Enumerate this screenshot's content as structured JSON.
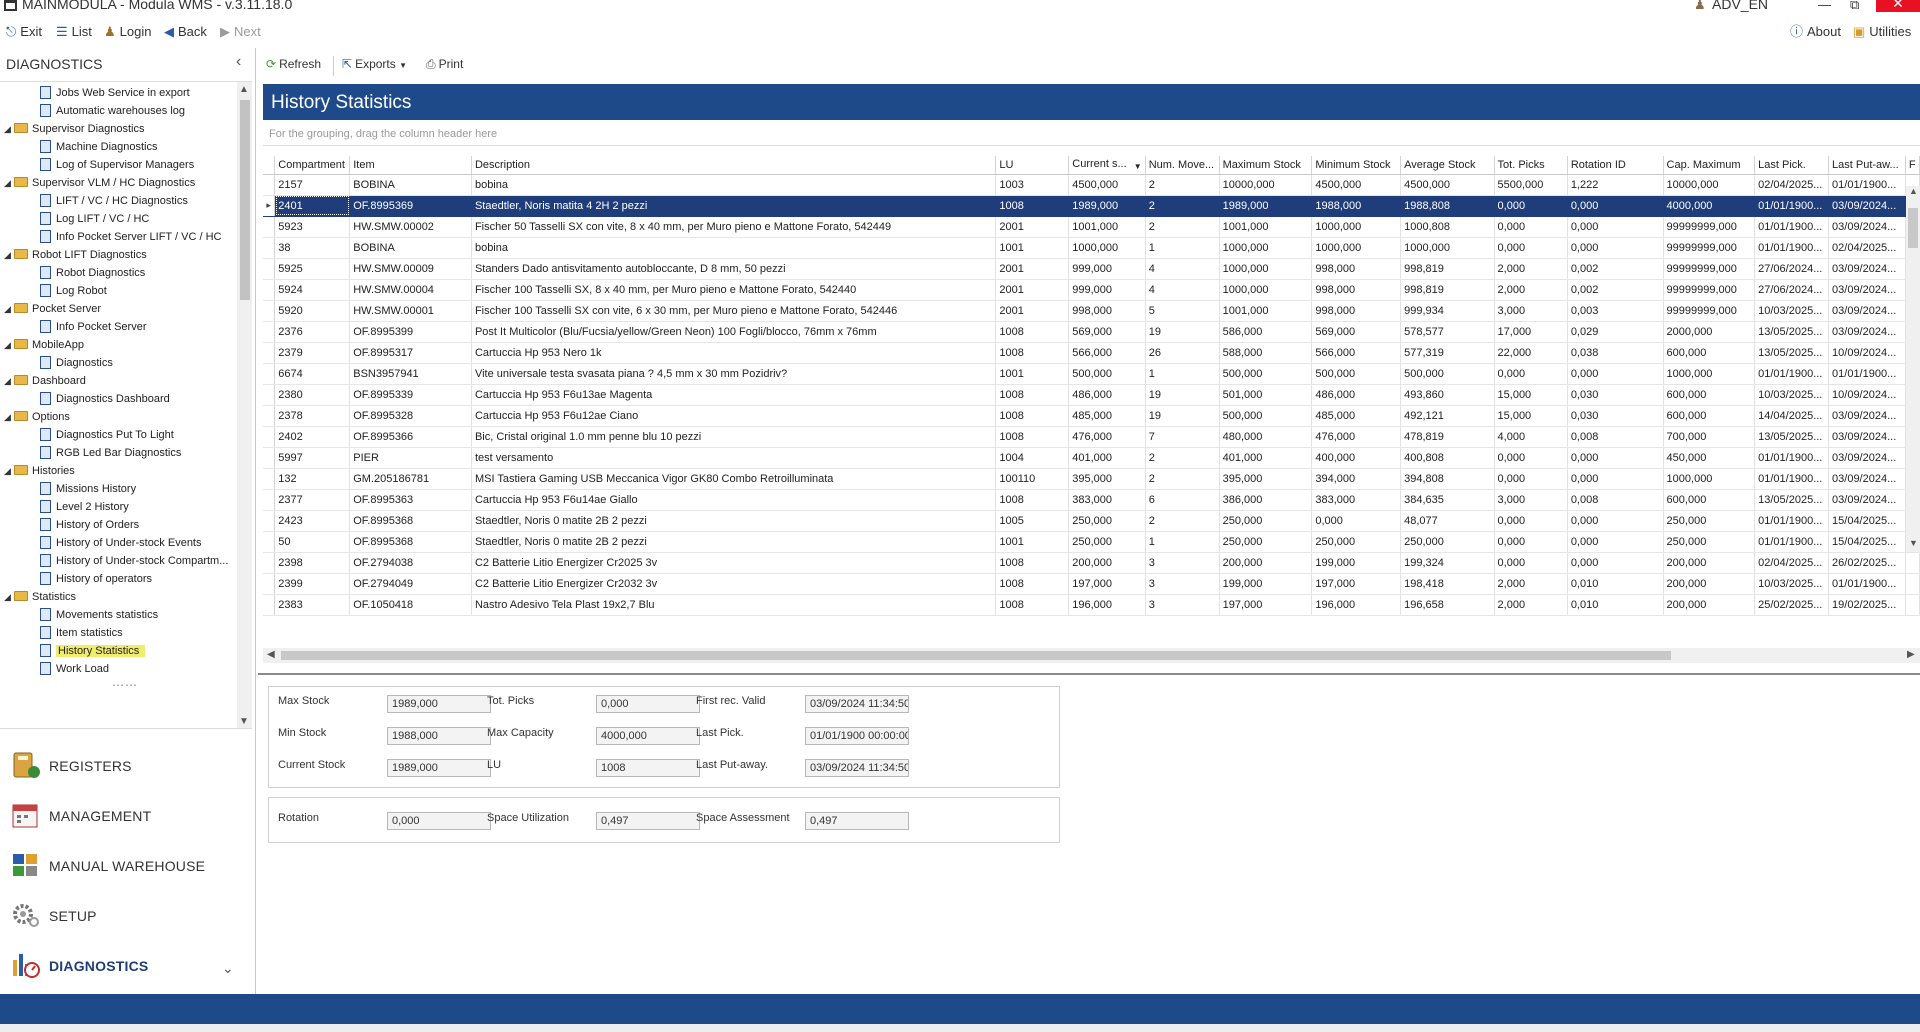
{
  "window": {
    "title": "MAINMODULA - Modula WMS - v.3.11.18.0",
    "user": "ADV_EN"
  },
  "topbar": {
    "exit": "Exit",
    "list": "List",
    "login": "Login",
    "back": "Back",
    "next": "Next",
    "about": "About",
    "utilities": "Utilities"
  },
  "sidebar": {
    "header": "DIAGNOSTICS",
    "tree": [
      {
        "label": "Jobs Web Service in export",
        "level": 1
      },
      {
        "label": "Automatic warehouses log",
        "level": 1
      },
      {
        "label": "Supervisor Diagnostics",
        "level": 0
      },
      {
        "label": "Machine Diagnostics",
        "level": 1
      },
      {
        "label": "Log of Supervisor Managers",
        "level": 1
      },
      {
        "label": "Supervisor VLM / HC Diagnostics",
        "level": 0
      },
      {
        "label": "LIFT / VC / HC Diagnostics",
        "level": 1
      },
      {
        "label": "Log LIFT / VC / HC",
        "level": 1
      },
      {
        "label": "Info Pocket Server LIFT / VC / HC",
        "level": 1
      },
      {
        "label": "Robot LIFT Diagnostics",
        "level": 0
      },
      {
        "label": "Robot Diagnostics",
        "level": 1
      },
      {
        "label": "Log Robot",
        "level": 1
      },
      {
        "label": "Pocket Server",
        "level": 0
      },
      {
        "label": "Info Pocket Server",
        "level": 1
      },
      {
        "label": "MobileApp",
        "level": 0
      },
      {
        "label": "Diagnostics",
        "level": 1
      },
      {
        "label": "Dashboard",
        "level": 0
      },
      {
        "label": "Diagnostics Dashboard",
        "level": 1
      },
      {
        "label": "Options",
        "level": 0
      },
      {
        "label": "Diagnostics Put To Light",
        "level": 1
      },
      {
        "label": "RGB Led Bar Diagnostics",
        "level": 1
      },
      {
        "label": "Histories",
        "level": 0
      },
      {
        "label": "Missions History",
        "level": 1
      },
      {
        "label": "Level 2 History",
        "level": 1
      },
      {
        "label": "History of Orders",
        "level": 1
      },
      {
        "label": "History of Under-stock Events",
        "level": 1
      },
      {
        "label": "History of Under-stock Compartm...",
        "level": 1
      },
      {
        "label": "History of operators",
        "level": 1
      },
      {
        "label": "Statistics",
        "level": 0
      },
      {
        "label": "Movements statistics",
        "level": 1
      },
      {
        "label": "Item statistics",
        "level": 1
      },
      {
        "label": "History Statistics",
        "level": 1,
        "selected": true
      },
      {
        "label": "Work Load",
        "level": 1
      }
    ],
    "modules": [
      {
        "label": "REGISTERS",
        "icon": "registers-icon"
      },
      {
        "label": "MANAGEMENT",
        "icon": "management-icon"
      },
      {
        "label": "MANUAL WAREHOUSE",
        "icon": "manual-warehouse-icon"
      },
      {
        "label": "SETUP",
        "icon": "setup-icon"
      },
      {
        "label": "DIAGNOSTICS",
        "icon": "diagnostics-icon",
        "active": true
      }
    ]
  },
  "toolbar": {
    "refresh": "Refresh",
    "exports": "Exports",
    "print": "Print"
  },
  "page": {
    "title": "History Statistics",
    "group_hint": "For the grouping, drag the column header here"
  },
  "grid": {
    "columns": [
      "Compartment",
      "Item",
      "Description",
      "LU",
      "Current s...",
      "Num. Move...",
      "Maximum Stock",
      "Minimum Stock",
      "Average Stock",
      "Tot. Picks",
      "Rotation ID",
      "Cap. Maximum",
      "Last Pick.",
      "Last Put-aw...",
      "F"
    ],
    "selected_row": 1,
    "rows": [
      [
        "2157",
        "BOBINA",
        "bobina",
        "1003",
        "4500,000",
        "2",
        "10000,000",
        "4500,000",
        "4500,000",
        "5500,000",
        "1,222",
        "10000,000",
        "02/04/2025...",
        "01/01/1900..."
      ],
      [
        "2401",
        "OF.8995369",
        "Staedtler, Noris matita 4 2H 2 pezzi",
        "1008",
        "1989,000",
        "2",
        "1989,000",
        "1988,000",
        "1988,808",
        "0,000",
        "0,000",
        "4000,000",
        "01/01/1900...",
        "03/09/2024..."
      ],
      [
        "5923",
        "HW.SMW.00002",
        "Fischer 50 Tasselli SX con vite, 8 x 40 mm, per Muro pieno e Mattone Forato, 542449",
        "2001",
        "1001,000",
        "2",
        "1001,000",
        "1000,000",
        "1000,808",
        "0,000",
        "0,000",
        "99999999,000",
        "01/01/1900...",
        "03/09/2024..."
      ],
      [
        "38",
        "BOBINA",
        "bobina",
        "1001",
        "1000,000",
        "1",
        "1000,000",
        "1000,000",
        "1000,000",
        "0,000",
        "0,000",
        "99999999,000",
        "01/01/1900...",
        "02/04/2025..."
      ],
      [
        "5925",
        "HW.SMW.00009",
        "Standers Dado antisvitamento autobloccante, D 8 mm, 50 pezzi",
        "2001",
        "999,000",
        "4",
        "1000,000",
        "998,000",
        "998,819",
        "2,000",
        "0,002",
        "99999999,000",
        "27/06/2024...",
        "03/09/2024..."
      ],
      [
        "5924",
        "HW.SMW.00004",
        "Fischer 100 Tasselli SX, 8 x 40 mm, per Muro pieno e Mattone Forato, 542440",
        "2001",
        "999,000",
        "4",
        "1000,000",
        "998,000",
        "998,819",
        "2,000",
        "0,002",
        "99999999,000",
        "27/06/2024...",
        "03/09/2024..."
      ],
      [
        "5920",
        "HW.SMW.00001",
        "Fischer 100 Tasselli SX con vite, 6 x 30 mm, per Muro pieno e Mattone Forato, 542446",
        "2001",
        "998,000",
        "5",
        "1001,000",
        "998,000",
        "999,934",
        "3,000",
        "0,003",
        "99999999,000",
        "10/03/2025...",
        "03/09/2024..."
      ],
      [
        "2376",
        "OF.8995399",
        "Post It Multicolor (Blu/Fucsia/yellow/Green Neon) 100 Fogli/blocco, 76mm x 76mm",
        "1008",
        "569,000",
        "19",
        "586,000",
        "569,000",
        "578,577",
        "17,000",
        "0,029",
        "2000,000",
        "13/05/2025...",
        "03/09/2024..."
      ],
      [
        "2379",
        "OF.8995317",
        "Cartuccia Hp 953 Nero 1k",
        "1008",
        "566,000",
        "26",
        "588,000",
        "566,000",
        "577,319",
        "22,000",
        "0,038",
        "600,000",
        "13/05/2025...",
        "10/09/2024..."
      ],
      [
        "6674",
        "BSN3957941",
        "Vite universale testa svasata piana ? 4,5 mm x 30 mm Pozidriv?",
        "1001",
        "500,000",
        "1",
        "500,000",
        "500,000",
        "500,000",
        "0,000",
        "0,000",
        "1000,000",
        "01/01/1900...",
        "01/01/1900..."
      ],
      [
        "2380",
        "OF.8995339",
        "Cartuccia Hp 953 F6u13ae Magenta",
        "1008",
        "486,000",
        "19",
        "501,000",
        "486,000",
        "493,860",
        "15,000",
        "0,030",
        "600,000",
        "10/03/2025...",
        "10/09/2024..."
      ],
      [
        "2378",
        "OF.8995328",
        "Cartuccia Hp 953 F6u12ae Ciano",
        "1008",
        "485,000",
        "19",
        "500,000",
        "485,000",
        "492,121",
        "15,000",
        "0,030",
        "600,000",
        "14/04/2025...",
        "03/09/2024..."
      ],
      [
        "2402",
        "OF.8995366",
        "Bic, Cristal original 1.0 mm penne blu 10 pezzi",
        "1008",
        "476,000",
        "7",
        "480,000",
        "476,000",
        "478,819",
        "4,000",
        "0,008",
        "700,000",
        "13/05/2025...",
        "03/09/2024..."
      ],
      [
        "5997",
        "PIER",
        "test versamento",
        "1004",
        "401,000",
        "2",
        "401,000",
        "400,000",
        "400,808",
        "0,000",
        "0,000",
        "450,000",
        "01/01/1900...",
        "03/09/2024..."
      ],
      [
        "132",
        "GM.205186781",
        "MSI Tastiera Gaming USB Meccanica Vigor GK80 Combo Retroilluminata",
        "100110",
        "395,000",
        "2",
        "395,000",
        "394,000",
        "394,808",
        "0,000",
        "0,000",
        "1000,000",
        "01/01/1900...",
        "03/09/2024..."
      ],
      [
        "2377",
        "OF.8995363",
        "Cartuccia Hp 953 F6u14ae Giallo",
        "1008",
        "383,000",
        "6",
        "386,000",
        "383,000",
        "384,635",
        "3,000",
        "0,008",
        "600,000",
        "13/05/2025...",
        "03/09/2024..."
      ],
      [
        "2423",
        "OF.8995368",
        "Staedtler, Noris 0 matite 2B 2 pezzi",
        "1005",
        "250,000",
        "2",
        "250,000",
        "0,000",
        "48,077",
        "0,000",
        "0,000",
        "250,000",
        "01/01/1900...",
        "15/04/2025..."
      ],
      [
        "50",
        "OF.8995368",
        "Staedtler, Noris 0 matite 2B 2 pezzi",
        "1001",
        "250,000",
        "1",
        "250,000",
        "250,000",
        "250,000",
        "0,000",
        "0,000",
        "250,000",
        "01/01/1900...",
        "15/04/2025..."
      ],
      [
        "2398",
        "OF.2794038",
        "C2 Batterie Litio Energizer Cr2025 3v",
        "1008",
        "200,000",
        "3",
        "200,000",
        "199,000",
        "199,324",
        "0,000",
        "0,000",
        "200,000",
        "02/04/2025...",
        "26/02/2025..."
      ],
      [
        "2399",
        "OF.2794049",
        "C2 Batterie Litio Energizer Cr2032 3v",
        "1008",
        "197,000",
        "3",
        "199,000",
        "197,000",
        "198,418",
        "2,000",
        "0,010",
        "200,000",
        "10/03/2025...",
        "01/01/1900..."
      ],
      [
        "2383",
        "OF.1050418",
        "Nastro Adesivo Tela Plast 19x2,7 Blu",
        "1008",
        "196,000",
        "3",
        "197,000",
        "196,000",
        "196,658",
        "2,000",
        "0,010",
        "200,000",
        "25/02/2025...",
        "19/02/2025..."
      ]
    ]
  },
  "details": {
    "max_stock_label": "Max Stock",
    "max_stock": "1989,000",
    "min_stock_label": "Min Stock",
    "min_stock": "1988,000",
    "current_stock_label": "Current Stock",
    "current_stock": "1989,000",
    "tot_picks_label": "Tot. Picks",
    "tot_picks": "0,000",
    "max_capacity_label": "Max Capacity",
    "max_capacity": "4000,000",
    "lu_label": "LU",
    "lu": "1008",
    "first_rec_label": "First rec. Valid",
    "first_rec": "03/09/2024 11:34:50",
    "last_pick_label": "Last Pick.",
    "last_pick": "01/01/1900 00:00:00",
    "last_putaway_label": "Last Put-away.",
    "last_putaway": "03/09/2024 11:34:50",
    "rotation_label": "Rotation",
    "rotation": "0,000",
    "space_util_label": "Space Utilization",
    "space_util": "0,497",
    "space_assess_label": "Space Assessment",
    "space_assess": "0,497"
  },
  "colors": {
    "header_blue": "#1f4a8a",
    "selection": "#1f3d7a",
    "tree_highlight": "#f0ec6c"
  }
}
